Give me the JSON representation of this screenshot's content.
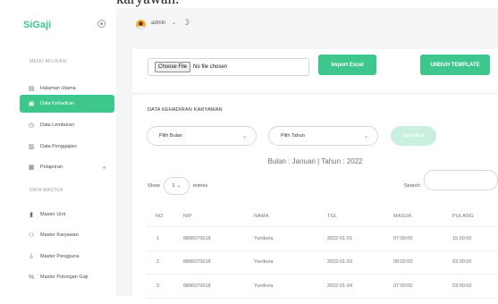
{
  "top_cutoff_text": "karyawan.",
  "sidebar": {
    "brand": "SiGaji",
    "sections": {
      "app": "MENU APLIKASI",
      "master": "DATA MASTER"
    },
    "items": [
      {
        "label": "Halaman Utama",
        "icon": "dashboard-icon"
      },
      {
        "label": "Data Kehadiran",
        "icon": "calendar-icon",
        "active": true
      },
      {
        "label": "Data Lemburan",
        "icon": "clock-icon"
      },
      {
        "label": "Data Penggajian",
        "icon": "money-icon"
      },
      {
        "label": "Pelaporan",
        "icon": "document-icon",
        "expand": "+"
      },
      {
        "label": "Master Unit",
        "icon": "building-icon"
      },
      {
        "label": "Master Karyawan",
        "icon": "users-icon"
      },
      {
        "label": "Master Pengguna",
        "icon": "lock-icon"
      },
      {
        "label": "Master Potongan Gaji",
        "icon": "percent-icon"
      }
    ]
  },
  "topbar": {
    "user": "admin",
    "user_caret": "⌄",
    "theme_icon": "☽"
  },
  "upload": {
    "file_button": "Choose File",
    "file_status": "No file chosen",
    "import_label": "Import Excel",
    "template_label": "UNDUH TEMPLATE"
  },
  "attendance": {
    "title": "DATA KEHADIRAN KARYAWAN",
    "bulan_placeholder": "Pilih Bulan",
    "tahun_placeholder": "Pilih Tahun",
    "show_button": "Tampilkan",
    "period": "Bulan : Januari | Tahun : 2022",
    "show_label": "Show",
    "entries_value": "1",
    "entries_label": "entries",
    "search_label": "Search:",
    "columns": [
      "NO",
      "NIP",
      "NAMA",
      "TGL",
      "MASUK",
      "PULANG"
    ],
    "rows": [
      [
        "1",
        "8806070018",
        "Yunikora",
        "2022-01-01",
        "07:00:00",
        "15:00:00"
      ],
      [
        "2",
        "8806070018",
        "Yunikora",
        "2022-01-03",
        "08:02:00",
        "03:00:00"
      ],
      [
        "3",
        "8806070018",
        "Yunikora",
        "2022-01-04",
        "07:00:00",
        "03:00:00"
      ]
    ]
  },
  "colors": {
    "accent": "#3ec78d",
    "accent_soft": "#c9efdf",
    "background": "#f4f5f7"
  }
}
